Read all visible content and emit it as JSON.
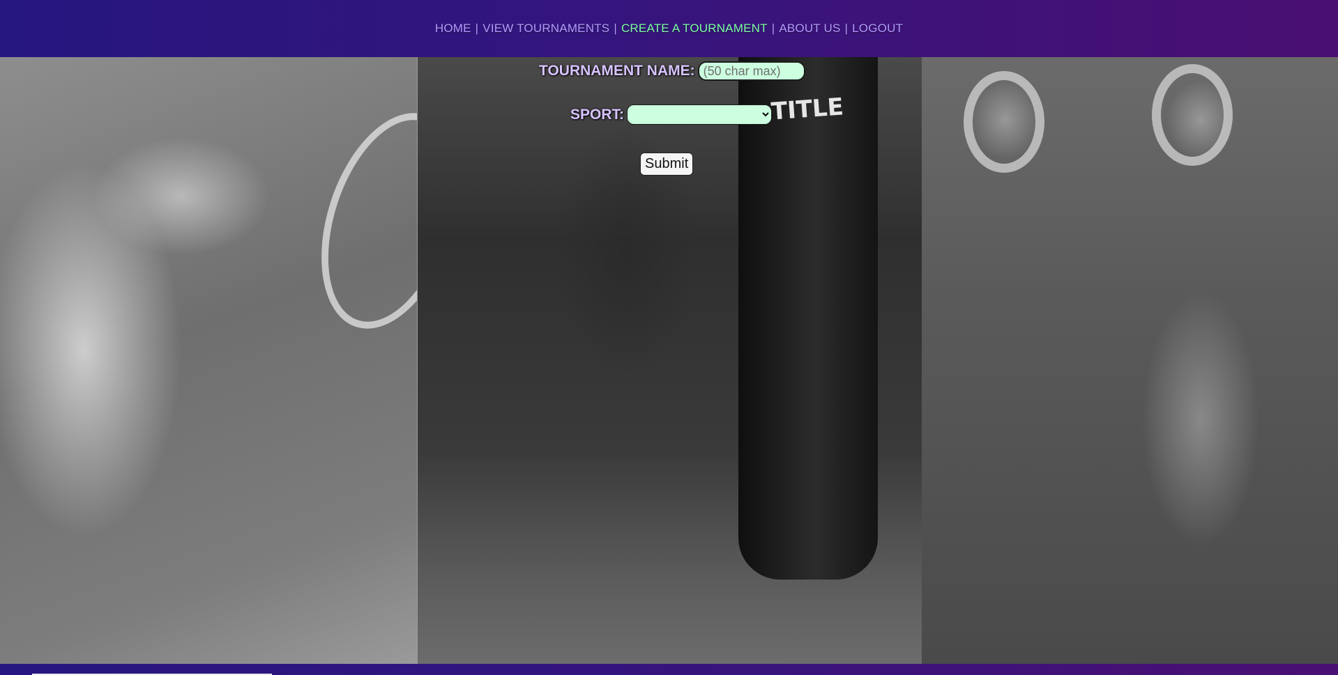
{
  "nav": {
    "items": [
      {
        "label": "HOME",
        "active": false
      },
      {
        "label": "VIEW TOURNAMENTS",
        "active": false
      },
      {
        "label": "CREATE A TOURNAMENT",
        "active": true
      },
      {
        "label": "ABOUT US",
        "active": false
      },
      {
        "label": "LOGOUT",
        "active": false
      }
    ],
    "separator": "|"
  },
  "form": {
    "name_label": "TOURNAMENT NAME:",
    "name_placeholder": "(50 char max)",
    "name_value": "",
    "sport_label": "SPORT:",
    "sport_selected": "",
    "submit_label": "Submit"
  },
  "panels": {
    "middle_bag_logo": "TITLE"
  },
  "colors": {
    "header_gradient_start": "#26167f",
    "header_gradient_end": "#4a0f72",
    "nav_link": "#b39cff",
    "nav_active": "#7dffa8",
    "input_bg": "#ccffe0",
    "label": "#d7c3ff"
  }
}
